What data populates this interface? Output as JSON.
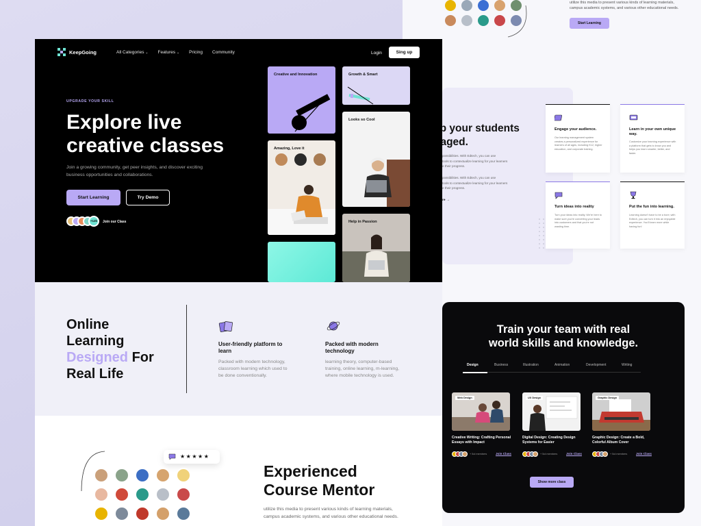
{
  "top_right": {
    "text": "utilize this media to present various kinds of learning materials, campus academic systems, and various other educational needs.",
    "button": "Start Learning"
  },
  "nav": {
    "brand": "KeepGoing",
    "items": [
      "All Categories",
      "Features",
      "Pricing",
      "Community"
    ],
    "login": "Login",
    "signup": "Sing up"
  },
  "hero": {
    "eyebrow": "UPGRADE YOUR SKILL",
    "title_line1": "Explore live",
    "title_line2": "creative classes",
    "subtitle": "Join a growing community, get peer insights, and discover exciting business opportunities and collaborations.",
    "primary_button": "Start Learning",
    "secondary_button": "Try Demo",
    "avatar_count": "+12k",
    "join_text": "Join our Class",
    "cards": {
      "creative": "Creative and Innovation",
      "growth": "Growth & Smart",
      "amazing": "Amazing, Love it",
      "cool": "Looks so Cool",
      "passion": "Help in Passion"
    }
  },
  "features": {
    "heading_line1": "Online",
    "heading_line2": "Learning",
    "heading_accent": "Designed",
    "heading_for": " For",
    "heading_line4": "Real Life",
    "items": [
      {
        "title": "User-friendly platform to learn",
        "text": "Packed with modern technology, classroom learning which used to be done conventionally."
      },
      {
        "title": "Packed with modern technology",
        "text": "learning theory, computer-based training, online learning, m-learning, where mobile technology is used."
      }
    ]
  },
  "mentor": {
    "rating": "★★★★★",
    "title_line1": "Experienced",
    "title_line2": "Course Mentor",
    "text": "utilize this media to present various kinds of learning materials, campus academic systems, and various other educational needs."
  },
  "engaged": {
    "title_line1": "ep your students",
    "title_line2": "gaged.",
    "para1_line1": "possibilities. With Edtech, you can use",
    "para1_line2": "tools to contextualize learning for your learners",
    "para1_line3": "e their progress.",
    "para2_line1": "possibilities. With Edtech, you can use",
    "para2_line2": "tools to contextualize learning for your learners",
    "para2_line3": "e their progress.",
    "link": "re",
    "cards": [
      {
        "title": "Engage your audience.",
        "text": "Our learning management system creates a personalized experience for learners of all ages, including K12, higher education, and corporate training."
      },
      {
        "title": "Learn in your own unique way.",
        "text": "Customize your learning experience with a platform that gets to know you and helps you learn smarter, better, and faster."
      },
      {
        "title": "Turn ideas into reality",
        "text": "Turn your ideas into reality. We're here to make sure you're converting your leads into customers and that you're not wasting time."
      },
      {
        "title": "Put the fun into learning.",
        "text": "Learning doesn't have to be a bore; with Edtech, you can turn it into an enjoyable experience. You'll learn more while having fun!"
      }
    ]
  },
  "train": {
    "title_line1": "Train your team with real",
    "title_line2": "world skills and knowledge.",
    "tabs": [
      "Design",
      "Business",
      "Illustration",
      "Animation",
      "Development",
      "Writing"
    ],
    "courses": [
      {
        "tag": "Web Design",
        "title": "Creative Writing: Crafting Personal Essays with Impact",
        "members": "+ 5ol members",
        "join": "Join Class"
      },
      {
        "tag": "UX Design",
        "title": "Digital Design: Creating Design Systems for Easier",
        "members": "+ 5ol members",
        "join": "Join Class"
      },
      {
        "tag": "Graphic Design",
        "title": "Graphic Design: Create a Bold, Colorful Album Cover",
        "members": "+ 5ol members",
        "join": "Join Class"
      }
    ],
    "more_button": "Show more class"
  },
  "colors": {
    "accent": "#b9a9f5",
    "dark": "#000000",
    "light_band": "#f0f0f8"
  }
}
